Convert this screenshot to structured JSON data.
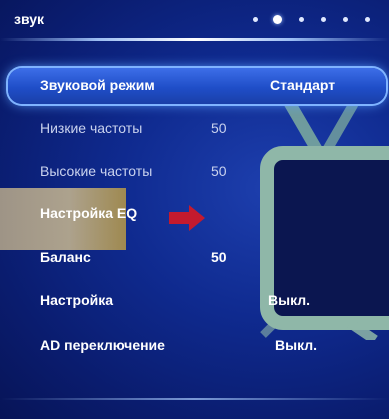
{
  "header": {
    "title": "звук",
    "page_dots": 6,
    "active_dot": 2
  },
  "menu": [
    {
      "label": "Звуковой режим",
      "value": "Стандарт",
      "state": "selected"
    },
    {
      "label": "Низкие частоты",
      "value": "50",
      "state": "dim"
    },
    {
      "label": "Высокие частоты",
      "value": "50",
      "state": "dim"
    },
    {
      "label": "Настройка EQ",
      "value": "",
      "state": "highlighted"
    },
    {
      "label": "Баланс",
      "value": "50",
      "state": "normal"
    },
    {
      "label": "Настройка",
      "value": "Выкл.",
      "state": "normal"
    },
    {
      "label": "AD переключение",
      "value": "Выкл.",
      "state": "normal"
    }
  ],
  "icons": {
    "arrow": "right-arrow-icon",
    "tv": "tv-icon"
  },
  "colors": {
    "background": "#0f2a8f",
    "selection": "#2a5ad8",
    "eq_highlight": "#c9b88f",
    "arrow": "#c41a2e",
    "tv_outline": "#8fb7a8"
  }
}
